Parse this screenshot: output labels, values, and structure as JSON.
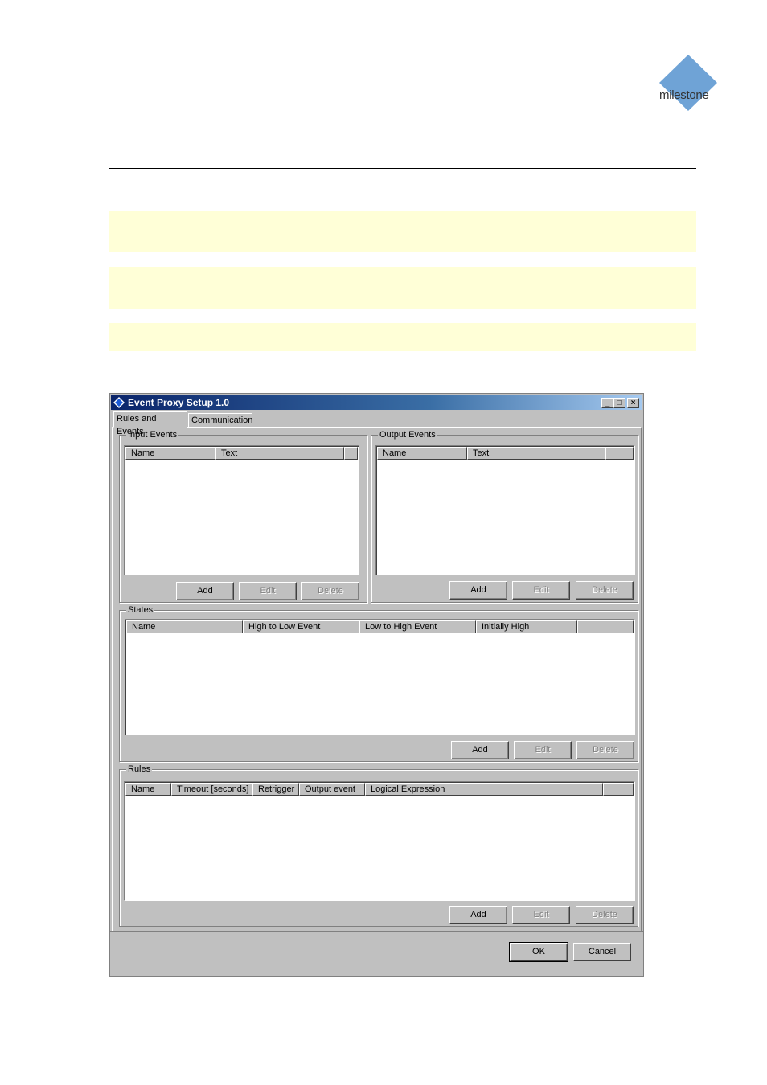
{
  "logo": {
    "text": "milestone",
    "color": "#6fa3d6"
  },
  "dialog": {
    "title": "Event Proxy Setup 1.0",
    "caption_buttons": {
      "minimize": "_",
      "maximize": "□",
      "close": "×"
    },
    "tabs": [
      {
        "label": "Rules and Events",
        "active": true
      },
      {
        "label": "Communication",
        "active": false
      }
    ],
    "input_events": {
      "label": "Input Events",
      "columns": [
        "Name",
        "Text"
      ],
      "buttons": {
        "add": "Add",
        "edit": "Edit",
        "delete": "Delete"
      }
    },
    "output_events": {
      "label": "Output Events",
      "columns": [
        "Name",
        "Text"
      ],
      "buttons": {
        "add": "Add",
        "edit": "Edit",
        "delete": "Delete"
      }
    },
    "states": {
      "label": "States",
      "columns": [
        "Name",
        "High to Low Event",
        "Low to High Event",
        "Initially High"
      ],
      "buttons": {
        "add": "Add",
        "edit": "Edit",
        "delete": "Delete"
      }
    },
    "rules": {
      "label": "Rules",
      "columns": [
        "Name",
        "Timeout [seconds]",
        "Retrigger",
        "Output event",
        "Logical Expression"
      ],
      "buttons": {
        "add": "Add",
        "edit": "Edit",
        "delete": "Delete"
      }
    },
    "ok_label": "OK",
    "cancel_label": "Cancel"
  }
}
